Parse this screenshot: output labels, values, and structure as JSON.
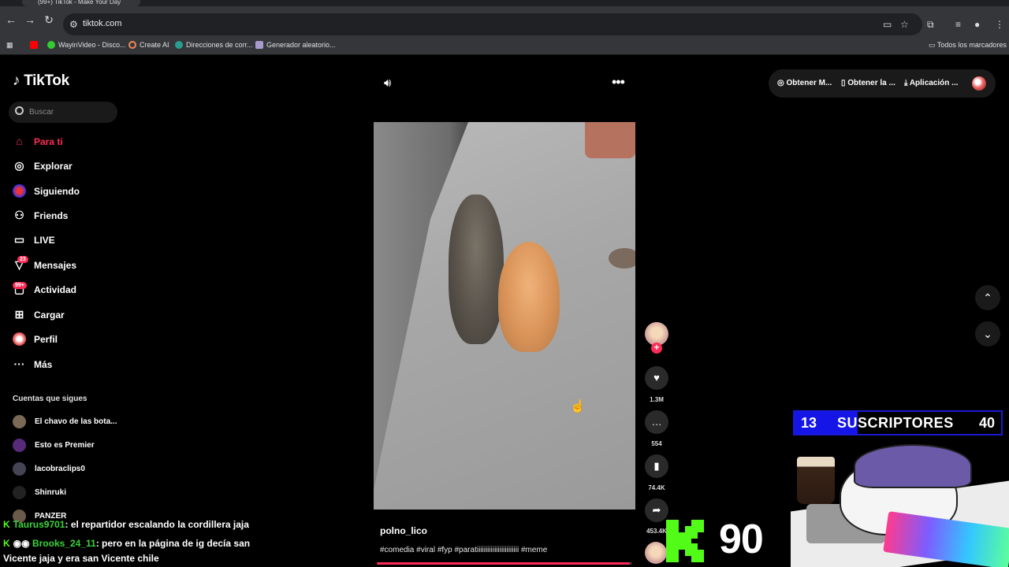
{
  "browser": {
    "tab_title": "(99+) TikTok - Make Your Day",
    "url": "tiktok.com",
    "bookmarks": [
      {
        "label": ""
      },
      {
        "label": "WayinVideo - Disco..."
      },
      {
        "label": "Create AI"
      },
      {
        "label": "Direcciones de corr..."
      },
      {
        "label": "Generador aleatorio..."
      }
    ],
    "all_bookmarks": "Todos los marcadores"
  },
  "sidebar": {
    "logo": "TikTok",
    "search_placeholder": "Buscar",
    "items": [
      {
        "label": "Para ti",
        "icon": "home-icon",
        "active": true
      },
      {
        "label": "Explorar",
        "icon": "compass-icon"
      },
      {
        "label": "Siguiendo",
        "icon": "following-icon"
      },
      {
        "label": "Friends",
        "icon": "friends-icon"
      },
      {
        "label": "LIVE",
        "icon": "live-icon"
      },
      {
        "label": "Mensajes",
        "icon": "messages-icon",
        "badge": "23"
      },
      {
        "label": "Actividad",
        "icon": "activity-icon",
        "badge": "99+"
      },
      {
        "label": "Cargar",
        "icon": "upload-icon"
      },
      {
        "label": "Perfil",
        "icon": "profile-icon"
      },
      {
        "label": "Más",
        "icon": "more-icon"
      }
    ],
    "following_title": "Cuentas que sigues",
    "accounts": [
      {
        "name": "El chavo de las bota..."
      },
      {
        "name": "Esto es Premier"
      },
      {
        "name": "lacobraclips0"
      },
      {
        "name": "Shinruki"
      },
      {
        "name": "PANZER"
      }
    ]
  },
  "topbar": {
    "get_m": "Obtener M...",
    "get_app": "Obtener la ...",
    "app": "Aplicación ..."
  },
  "video": {
    "author": "polno_lico",
    "caption": "#comedia #viral #fyp #paratiiiiiiiiiiiiiiiiiiiiiiii #meme",
    "progress": 0.99,
    "likes": "1.3M",
    "comments": "554",
    "saves": "74.4K",
    "shares": "453.4K"
  },
  "overlay": {
    "chat": [
      {
        "user": "Taurus9701",
        "message": ": el repartidor escalando la cordillera jaja"
      },
      {
        "user": "Brooks_24_11",
        "message": ": pero en la página de ig decía san"
      },
      {
        "user": "",
        "message": "Vicente jaja y era san Vicente chile"
      }
    ],
    "subs_current": "13",
    "subs_label": "SUSCRIPTORES",
    "subs_goal": "40",
    "kick_count": "90",
    "colors": {
      "kick_green": "#53fc18",
      "subs_blue": "#1515e8",
      "tiktok_red": "#fe2c55"
    }
  }
}
